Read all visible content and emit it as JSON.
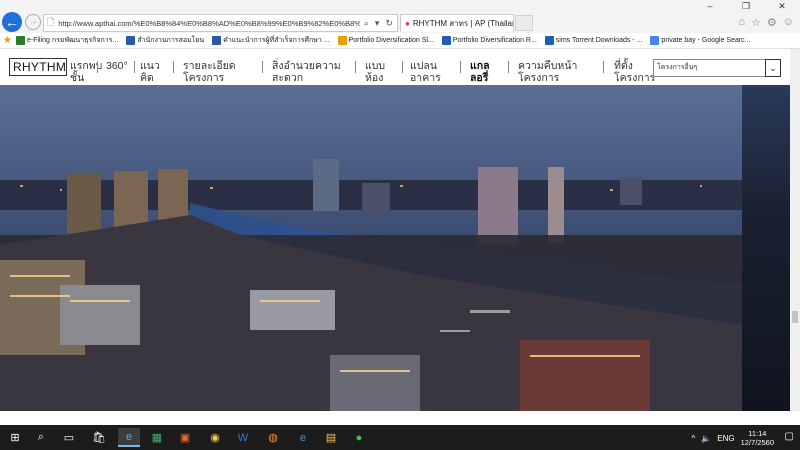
{
  "browser": {
    "address": "http://www.apthai.com/%E0%B8%84%E0%B8%AD%E0%B8%99%E0%B9%82%E0%B8%94/rhythm/m",
    "tab_title": "RHYTHM สาทร | AP (Thailan...",
    "window_controls": [
      "–",
      "❐",
      "✕"
    ]
  },
  "favorites": [
    {
      "label": "e-Filing กรมพัฒนาธุรกิจการ...",
      "color": "#2a7b2a"
    },
    {
      "label": "สำนักงานการสอบโยน",
      "color": "#2a5aa5"
    },
    {
      "label": "คำแนะนำการผู้ที่สำเร็จการศึกษา ...",
      "color": "#2a5aa5"
    },
    {
      "label": "Portfolio Diversification Sl...",
      "color": "#e8a000"
    },
    {
      "label": "Portfolio Diversification R...",
      "color": "#1f5fb0"
    },
    {
      "label": "sims Torrent Downloads - ...",
      "color": "#1f5fb0"
    },
    {
      "label": "private bay - Google Searc...",
      "color": "#4285f4"
    }
  ],
  "site": {
    "logo": "RHYTHM",
    "nav": [
      {
        "label": "แรกพบ\nชั้น",
        "active": false
      },
      {
        "label": "360°",
        "active": false
      },
      {
        "label": "แนว\nคิด",
        "active": false
      },
      {
        "label": "รายละเอียด\nโครงการ",
        "active": false
      },
      {
        "label": "สิ่งอำนวยความ\nสะดวก",
        "active": false
      },
      {
        "label": "แบบ\nห้อง",
        "active": false
      },
      {
        "label": "แปลน\nอาคาร",
        "active": false
      },
      {
        "label": "แกล\nลอรี่",
        "active": true
      },
      {
        "label": "ความคืบหน้า\nโครงการ",
        "active": false
      },
      {
        "label": "ที่ตั้ง\nโครงการ",
        "active": false
      }
    ],
    "project_select": "โครงการอื่นๆ"
  },
  "taskbar": {
    "lang": "ENG",
    "time": "11:14",
    "date": "12/7/2560"
  }
}
